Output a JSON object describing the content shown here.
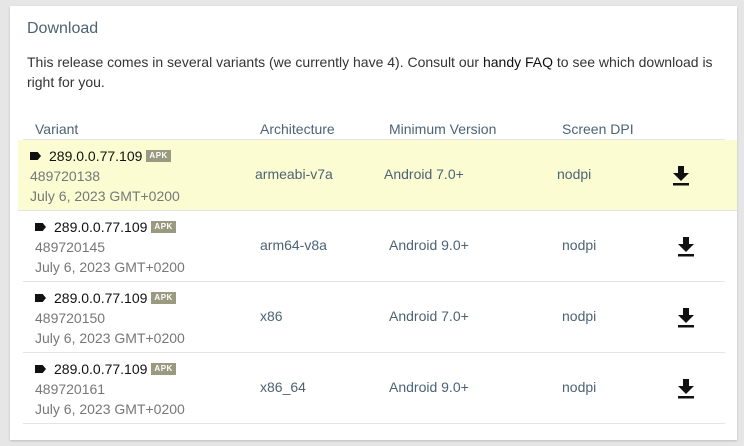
{
  "section": {
    "title": "Download",
    "intro_before": "This release comes in several variants (we currently have 4). Consult our ",
    "faq_link": "handy FAQ",
    "intro_after": " to see which download is right for you."
  },
  "table": {
    "headers": [
      "Variant",
      "Architecture",
      "Minimum Version",
      "Screen DPI"
    ],
    "badge": "APK",
    "rows": [
      {
        "version": "289.0.0.77.109",
        "code": "489720138",
        "date": "July 6, 2023 GMT+0200",
        "arch": "armeabi-v7a",
        "min_version": "Android 7.0+",
        "dpi": "nodpi",
        "highlighted": true
      },
      {
        "version": "289.0.0.77.109",
        "code": "489720145",
        "date": "July 6, 2023 GMT+0200",
        "arch": "arm64-v8a",
        "min_version": "Android 9.0+",
        "dpi": "nodpi"
      },
      {
        "version": "289.0.0.77.109",
        "code": "489720150",
        "date": "July 6, 2023 GMT+0200",
        "arch": "x86",
        "min_version": "Android 7.0+",
        "dpi": "nodpi"
      },
      {
        "version": "289.0.0.77.109",
        "code": "489720161",
        "date": "July 6, 2023 GMT+0200",
        "arch": "x86_64",
        "min_version": "Android 9.0+",
        "dpi": "nodpi"
      }
    ]
  },
  "icons": {
    "variant": "tag-icon",
    "download": "download-icon"
  },
  "colors": {
    "highlight": "#fcfcd3",
    "heading": "#4d6375",
    "badge": "#9a9a80"
  }
}
